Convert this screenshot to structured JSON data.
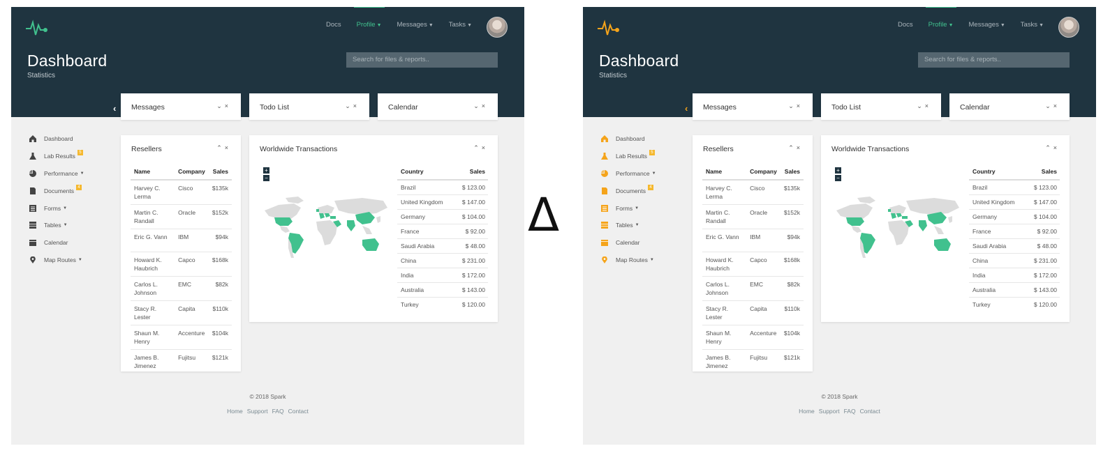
{
  "nav": {
    "docs": "Docs",
    "profile": "Profile",
    "messages": "Messages",
    "tasks": "Tasks"
  },
  "header": {
    "title": "Dashboard",
    "subtitle": "Statistics",
    "search_placeholder": "Search for files & reports.."
  },
  "widgets": {
    "messages": "Messages",
    "todo": "Todo List",
    "calendar": "Calendar"
  },
  "sidebar": {
    "items": [
      {
        "label": "Dashboard",
        "icon": "home-icon"
      },
      {
        "label": "Lab Results",
        "icon": "flask-icon",
        "badge": "5"
      },
      {
        "label": "Performance",
        "icon": "pie-chart-icon",
        "caret": true
      },
      {
        "label": "Documents",
        "icon": "document-icon",
        "badge": "4"
      },
      {
        "label": "Forms",
        "icon": "form-icon",
        "caret": true
      },
      {
        "label": "Tables",
        "icon": "table-icon",
        "caret": true
      },
      {
        "label": "Calendar",
        "icon": "calendar-icon"
      },
      {
        "label": "Map Routes",
        "icon": "map-pin-icon",
        "caret": true
      }
    ]
  },
  "resellers": {
    "title": "Resellers",
    "headers": [
      "Name",
      "Company",
      "Sales"
    ],
    "rows": [
      [
        "Harvey C. Lerma",
        "Cisco",
        "$135k"
      ],
      [
        "Martin C. Randall",
        "Oracle",
        "$152k"
      ],
      [
        "Eric G. Vann",
        "IBM",
        "$94k"
      ],
      [
        "Howard K. Haubrich",
        "Capco",
        "$168k"
      ],
      [
        "Carlos L. Johnson",
        "EMC",
        "$82k"
      ],
      [
        "Stacy R. Lester",
        "Capita",
        "$110k"
      ],
      [
        "Shaun M. Henry",
        "Accenture",
        "$104k"
      ],
      [
        "James B. Jimenez",
        "Fujitsu",
        "$121k"
      ]
    ]
  },
  "transactions": {
    "title": "Worldwide Transactions",
    "headers": [
      "Country",
      "Sales"
    ],
    "rows": [
      [
        "Brazil",
        "$ 123.00"
      ],
      [
        "United Kingdom",
        "$ 147.00"
      ],
      [
        "Germany",
        "$ 104.00"
      ],
      [
        "France",
        "$ 92.00"
      ],
      [
        "Saudi Arabia",
        "$ 48.00"
      ],
      [
        "China",
        "$ 231.00"
      ],
      [
        "India",
        "$ 172.00"
      ],
      [
        "Australia",
        "$ 143.00"
      ],
      [
        "Turkey",
        "$ 120.00"
      ]
    ],
    "zoom_in": "+",
    "zoom_out": "−"
  },
  "footer": {
    "copyright": "© 2018 Spark",
    "links": [
      "Home",
      "Support",
      "FAQ",
      "Contact"
    ]
  },
  "between_label": "Δ",
  "colors": {
    "header_bg": "#1f3440",
    "accent_green": "#41c18e",
    "accent_orange": "#f5a41b",
    "badge": "#f5b82e",
    "page_bg": "#f0f0f0"
  }
}
